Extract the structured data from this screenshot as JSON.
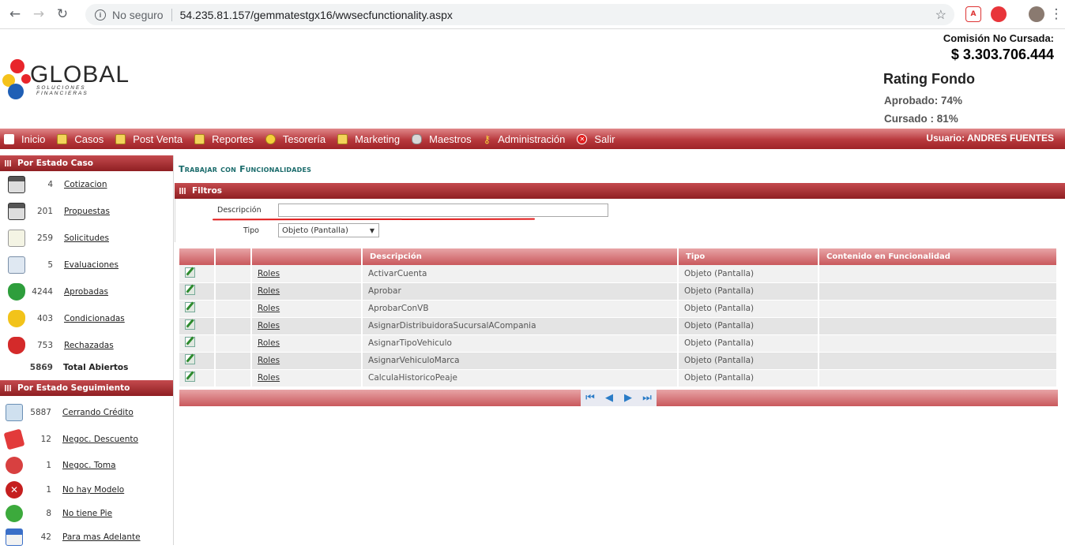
{
  "browser": {
    "security_label": "No seguro",
    "url": "54.235.81.157/gemmatestgx16/wwsecfunctionality.aspx"
  },
  "header": {
    "logo_word": "GLOBAL",
    "logo_tagline": "SOLUCIONES FINANCIERAS",
    "commission_label": "Comisión No Cursada:",
    "commission_value": "$ 3.303.706.444",
    "rating_title": "Rating Fondo",
    "approved": "Aprobado: 74%",
    "processed": "Cursado : 81%"
  },
  "menu": {
    "items": [
      "Inicio",
      "Casos",
      "Post Venta",
      "Reportes",
      "Tesorería",
      "Marketing",
      "Maestros",
      "Administración",
      "Salir"
    ],
    "user": "Usuario:  ANDRES FUENTES"
  },
  "sidebar": {
    "section1_title": "Por Estado Caso",
    "section1": [
      {
        "count": "4",
        "label": "Cotizacion"
      },
      {
        "count": "201",
        "label": "Propuestas"
      },
      {
        "count": "259",
        "label": "Solicitudes"
      },
      {
        "count": "5",
        "label": "Evaluaciones"
      },
      {
        "count": "4244",
        "label": "Aprobadas"
      },
      {
        "count": "403",
        "label": "Condicionadas"
      },
      {
        "count": "753",
        "label": "Rechazadas"
      }
    ],
    "total_count": "5869",
    "total_label": "Total Abiertos",
    "section2_title": "Por Estado Seguimiento",
    "section2": [
      {
        "count": "5887",
        "label": "Cerrando Crédito"
      },
      {
        "count": "12",
        "label": "Negoc. Descuento"
      },
      {
        "count": "1",
        "label": "Negoc. Toma"
      },
      {
        "count": "1",
        "label": "No hay Modelo"
      },
      {
        "count": "8",
        "label": "No tiene Pie"
      },
      {
        "count": "42",
        "label": "Para mas Adelante"
      }
    ]
  },
  "main": {
    "title": "Trabajar con Funcionalidades",
    "filters_title": "Filtros",
    "description_label": "Descripción",
    "description_value": "",
    "type_label": "Tipo",
    "type_value": "Objeto (Pantalla)",
    "columns": [
      "",
      "",
      "",
      "Descripción",
      "Tipo",
      "Contenido en Funcionalidad"
    ],
    "rows": [
      {
        "link": "Roles",
        "description": "ActivarCuenta",
        "type": "Objeto (Pantalla)",
        "content": ""
      },
      {
        "link": "Roles",
        "description": "Aprobar",
        "type": "Objeto (Pantalla)",
        "content": ""
      },
      {
        "link": "Roles",
        "description": "AprobarConVB",
        "type": "Objeto (Pantalla)",
        "content": ""
      },
      {
        "link": "Roles",
        "description": "AsignarDistribuidoraSucursalACompania",
        "type": "Objeto (Pantalla)",
        "content": ""
      },
      {
        "link": "Roles",
        "description": "AsignarTipoVehiculo",
        "type": "Objeto (Pantalla)",
        "content": ""
      },
      {
        "link": "Roles",
        "description": "AsignarVehiculoMarca",
        "type": "Objeto (Pantalla)",
        "content": ""
      },
      {
        "link": "Roles",
        "description": "CalculaHistoricoPeaje",
        "type": "Objeto (Pantalla)",
        "content": ""
      }
    ]
  },
  "colors": {
    "menu_red": "#b8393d",
    "title_teal": "#1a6b6b",
    "grid_header": "#c9585c"
  }
}
